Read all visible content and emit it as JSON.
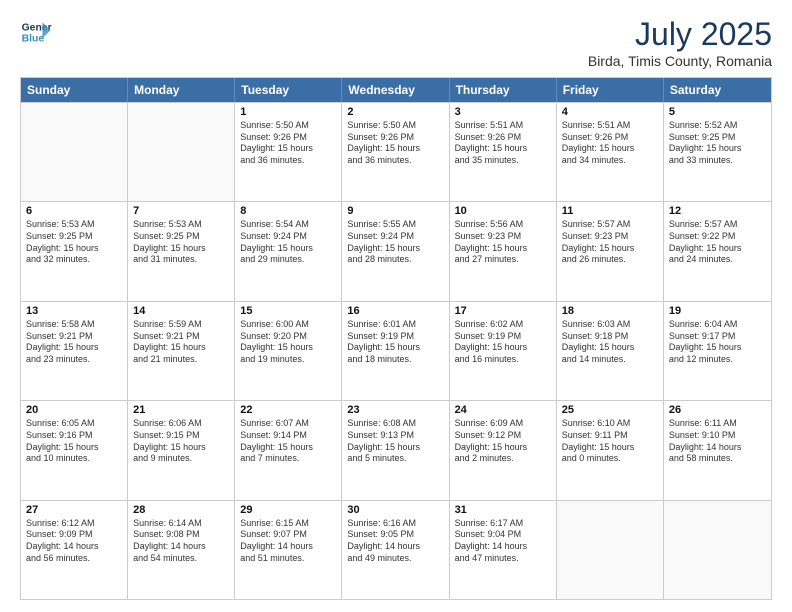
{
  "header": {
    "logo_line1": "General",
    "logo_line2": "Blue",
    "month_year": "July 2025",
    "location": "Birda, Timis County, Romania"
  },
  "weekdays": [
    "Sunday",
    "Monday",
    "Tuesday",
    "Wednesday",
    "Thursday",
    "Friday",
    "Saturday"
  ],
  "weeks": [
    [
      {
        "day": "",
        "lines": []
      },
      {
        "day": "",
        "lines": []
      },
      {
        "day": "1",
        "lines": [
          "Sunrise: 5:50 AM",
          "Sunset: 9:26 PM",
          "Daylight: 15 hours",
          "and 36 minutes."
        ]
      },
      {
        "day": "2",
        "lines": [
          "Sunrise: 5:50 AM",
          "Sunset: 9:26 PM",
          "Daylight: 15 hours",
          "and 36 minutes."
        ]
      },
      {
        "day": "3",
        "lines": [
          "Sunrise: 5:51 AM",
          "Sunset: 9:26 PM",
          "Daylight: 15 hours",
          "and 35 minutes."
        ]
      },
      {
        "day": "4",
        "lines": [
          "Sunrise: 5:51 AM",
          "Sunset: 9:26 PM",
          "Daylight: 15 hours",
          "and 34 minutes."
        ]
      },
      {
        "day": "5",
        "lines": [
          "Sunrise: 5:52 AM",
          "Sunset: 9:25 PM",
          "Daylight: 15 hours",
          "and 33 minutes."
        ]
      }
    ],
    [
      {
        "day": "6",
        "lines": [
          "Sunrise: 5:53 AM",
          "Sunset: 9:25 PM",
          "Daylight: 15 hours",
          "and 32 minutes."
        ]
      },
      {
        "day": "7",
        "lines": [
          "Sunrise: 5:53 AM",
          "Sunset: 9:25 PM",
          "Daylight: 15 hours",
          "and 31 minutes."
        ]
      },
      {
        "day": "8",
        "lines": [
          "Sunrise: 5:54 AM",
          "Sunset: 9:24 PM",
          "Daylight: 15 hours",
          "and 29 minutes."
        ]
      },
      {
        "day": "9",
        "lines": [
          "Sunrise: 5:55 AM",
          "Sunset: 9:24 PM",
          "Daylight: 15 hours",
          "and 28 minutes."
        ]
      },
      {
        "day": "10",
        "lines": [
          "Sunrise: 5:56 AM",
          "Sunset: 9:23 PM",
          "Daylight: 15 hours",
          "and 27 minutes."
        ]
      },
      {
        "day": "11",
        "lines": [
          "Sunrise: 5:57 AM",
          "Sunset: 9:23 PM",
          "Daylight: 15 hours",
          "and 26 minutes."
        ]
      },
      {
        "day": "12",
        "lines": [
          "Sunrise: 5:57 AM",
          "Sunset: 9:22 PM",
          "Daylight: 15 hours",
          "and 24 minutes."
        ]
      }
    ],
    [
      {
        "day": "13",
        "lines": [
          "Sunrise: 5:58 AM",
          "Sunset: 9:21 PM",
          "Daylight: 15 hours",
          "and 23 minutes."
        ]
      },
      {
        "day": "14",
        "lines": [
          "Sunrise: 5:59 AM",
          "Sunset: 9:21 PM",
          "Daylight: 15 hours",
          "and 21 minutes."
        ]
      },
      {
        "day": "15",
        "lines": [
          "Sunrise: 6:00 AM",
          "Sunset: 9:20 PM",
          "Daylight: 15 hours",
          "and 19 minutes."
        ]
      },
      {
        "day": "16",
        "lines": [
          "Sunrise: 6:01 AM",
          "Sunset: 9:19 PM",
          "Daylight: 15 hours",
          "and 18 minutes."
        ]
      },
      {
        "day": "17",
        "lines": [
          "Sunrise: 6:02 AM",
          "Sunset: 9:19 PM",
          "Daylight: 15 hours",
          "and 16 minutes."
        ]
      },
      {
        "day": "18",
        "lines": [
          "Sunrise: 6:03 AM",
          "Sunset: 9:18 PM",
          "Daylight: 15 hours",
          "and 14 minutes."
        ]
      },
      {
        "day": "19",
        "lines": [
          "Sunrise: 6:04 AM",
          "Sunset: 9:17 PM",
          "Daylight: 15 hours",
          "and 12 minutes."
        ]
      }
    ],
    [
      {
        "day": "20",
        "lines": [
          "Sunrise: 6:05 AM",
          "Sunset: 9:16 PM",
          "Daylight: 15 hours",
          "and 10 minutes."
        ]
      },
      {
        "day": "21",
        "lines": [
          "Sunrise: 6:06 AM",
          "Sunset: 9:15 PM",
          "Daylight: 15 hours",
          "and 9 minutes."
        ]
      },
      {
        "day": "22",
        "lines": [
          "Sunrise: 6:07 AM",
          "Sunset: 9:14 PM",
          "Daylight: 15 hours",
          "and 7 minutes."
        ]
      },
      {
        "day": "23",
        "lines": [
          "Sunrise: 6:08 AM",
          "Sunset: 9:13 PM",
          "Daylight: 15 hours",
          "and 5 minutes."
        ]
      },
      {
        "day": "24",
        "lines": [
          "Sunrise: 6:09 AM",
          "Sunset: 9:12 PM",
          "Daylight: 15 hours",
          "and 2 minutes."
        ]
      },
      {
        "day": "25",
        "lines": [
          "Sunrise: 6:10 AM",
          "Sunset: 9:11 PM",
          "Daylight: 15 hours",
          "and 0 minutes."
        ]
      },
      {
        "day": "26",
        "lines": [
          "Sunrise: 6:11 AM",
          "Sunset: 9:10 PM",
          "Daylight: 14 hours",
          "and 58 minutes."
        ]
      }
    ],
    [
      {
        "day": "27",
        "lines": [
          "Sunrise: 6:12 AM",
          "Sunset: 9:09 PM",
          "Daylight: 14 hours",
          "and 56 minutes."
        ]
      },
      {
        "day": "28",
        "lines": [
          "Sunrise: 6:14 AM",
          "Sunset: 9:08 PM",
          "Daylight: 14 hours",
          "and 54 minutes."
        ]
      },
      {
        "day": "29",
        "lines": [
          "Sunrise: 6:15 AM",
          "Sunset: 9:07 PM",
          "Daylight: 14 hours",
          "and 51 minutes."
        ]
      },
      {
        "day": "30",
        "lines": [
          "Sunrise: 6:16 AM",
          "Sunset: 9:05 PM",
          "Daylight: 14 hours",
          "and 49 minutes."
        ]
      },
      {
        "day": "31",
        "lines": [
          "Sunrise: 6:17 AM",
          "Sunset: 9:04 PM",
          "Daylight: 14 hours",
          "and 47 minutes."
        ]
      },
      {
        "day": "",
        "lines": []
      },
      {
        "day": "",
        "lines": []
      }
    ]
  ]
}
